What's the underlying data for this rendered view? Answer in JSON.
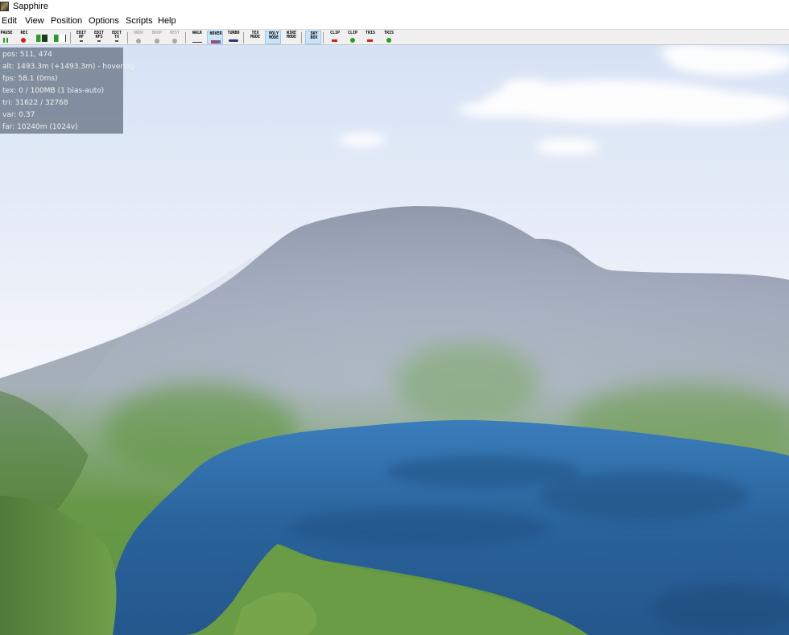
{
  "window": {
    "title": "Sapphire",
    "icon": "app-icon"
  },
  "menu": [
    "Edit",
    "View",
    "Position",
    "Options",
    "Scripts",
    "Help"
  ],
  "toolbar": [
    {
      "label": "PAUSE",
      "icon": "pause-icon",
      "color": "#2a9a2a"
    },
    {
      "label": "REC",
      "icon": "record-icon",
      "color": "#d02020"
    },
    {
      "label": "",
      "icon": "save-icon",
      "color": "#2a7a2a"
    },
    {
      "label": "",
      "icon": "load-icon",
      "color": "#2a9a2a"
    },
    {
      "label": "EDIT\nHF",
      "icon": "edit-heightfield-icon"
    },
    {
      "label": "EDIT\nHFS",
      "icon": "edit-heightfields-icon"
    },
    {
      "label": "EDIT\nTX",
      "icon": "edit-texture-icon"
    },
    {
      "label": "UNDO",
      "icon": "undo-icon",
      "disabled": true
    },
    {
      "label": "BKUP",
      "icon": "backup-icon",
      "disabled": true
    },
    {
      "label": "REST",
      "icon": "restore-icon",
      "disabled": true
    },
    {
      "label": "WALK",
      "icon": "walk-icon"
    },
    {
      "label": "HOVER",
      "icon": "hover-icon",
      "active": true
    },
    {
      "label": "TURBO",
      "icon": "turbo-icon"
    },
    {
      "label": "TEX\nMODE",
      "icon": "texture-mode-icon"
    },
    {
      "label": "POLY\nMODE",
      "icon": "poly-mode-icon",
      "active": true
    },
    {
      "label": "WIRE\nMODE",
      "icon": "wire-mode-icon"
    },
    {
      "label": "SKY\nBOX",
      "icon": "skybox-icon",
      "active": true
    },
    {
      "label": "CLIP",
      "icon": "clip-minus-icon",
      "color": "#d02020"
    },
    {
      "label": "CLIP",
      "icon": "clip-plus-icon",
      "color": "#2a9a2a"
    },
    {
      "label": "TRIS",
      "icon": "tris-minus-icon",
      "color": "#d02020"
    },
    {
      "label": "TRIS",
      "icon": "tris-plus-icon",
      "color": "#2a9a2a"
    }
  ],
  "stats": [
    "pos: 511, 474",
    "alt: 1493.3m (+1493.3m) - hovering",
    "fps: 58.1 (0ms)",
    "tex: 0 / 100MB (1 bias-auto)",
    "tri: 31622 / 32768",
    "var: 0.37",
    "far: 10240m (1024v)"
  ],
  "colors": {
    "sky_top": "#dbe6f7",
    "sky_horizon": "#f4f6fb",
    "mountain": "#9ea7ba",
    "grass": "#6f9e4a",
    "water": "#2f6fa8",
    "overlay": "#5f6c7d"
  }
}
